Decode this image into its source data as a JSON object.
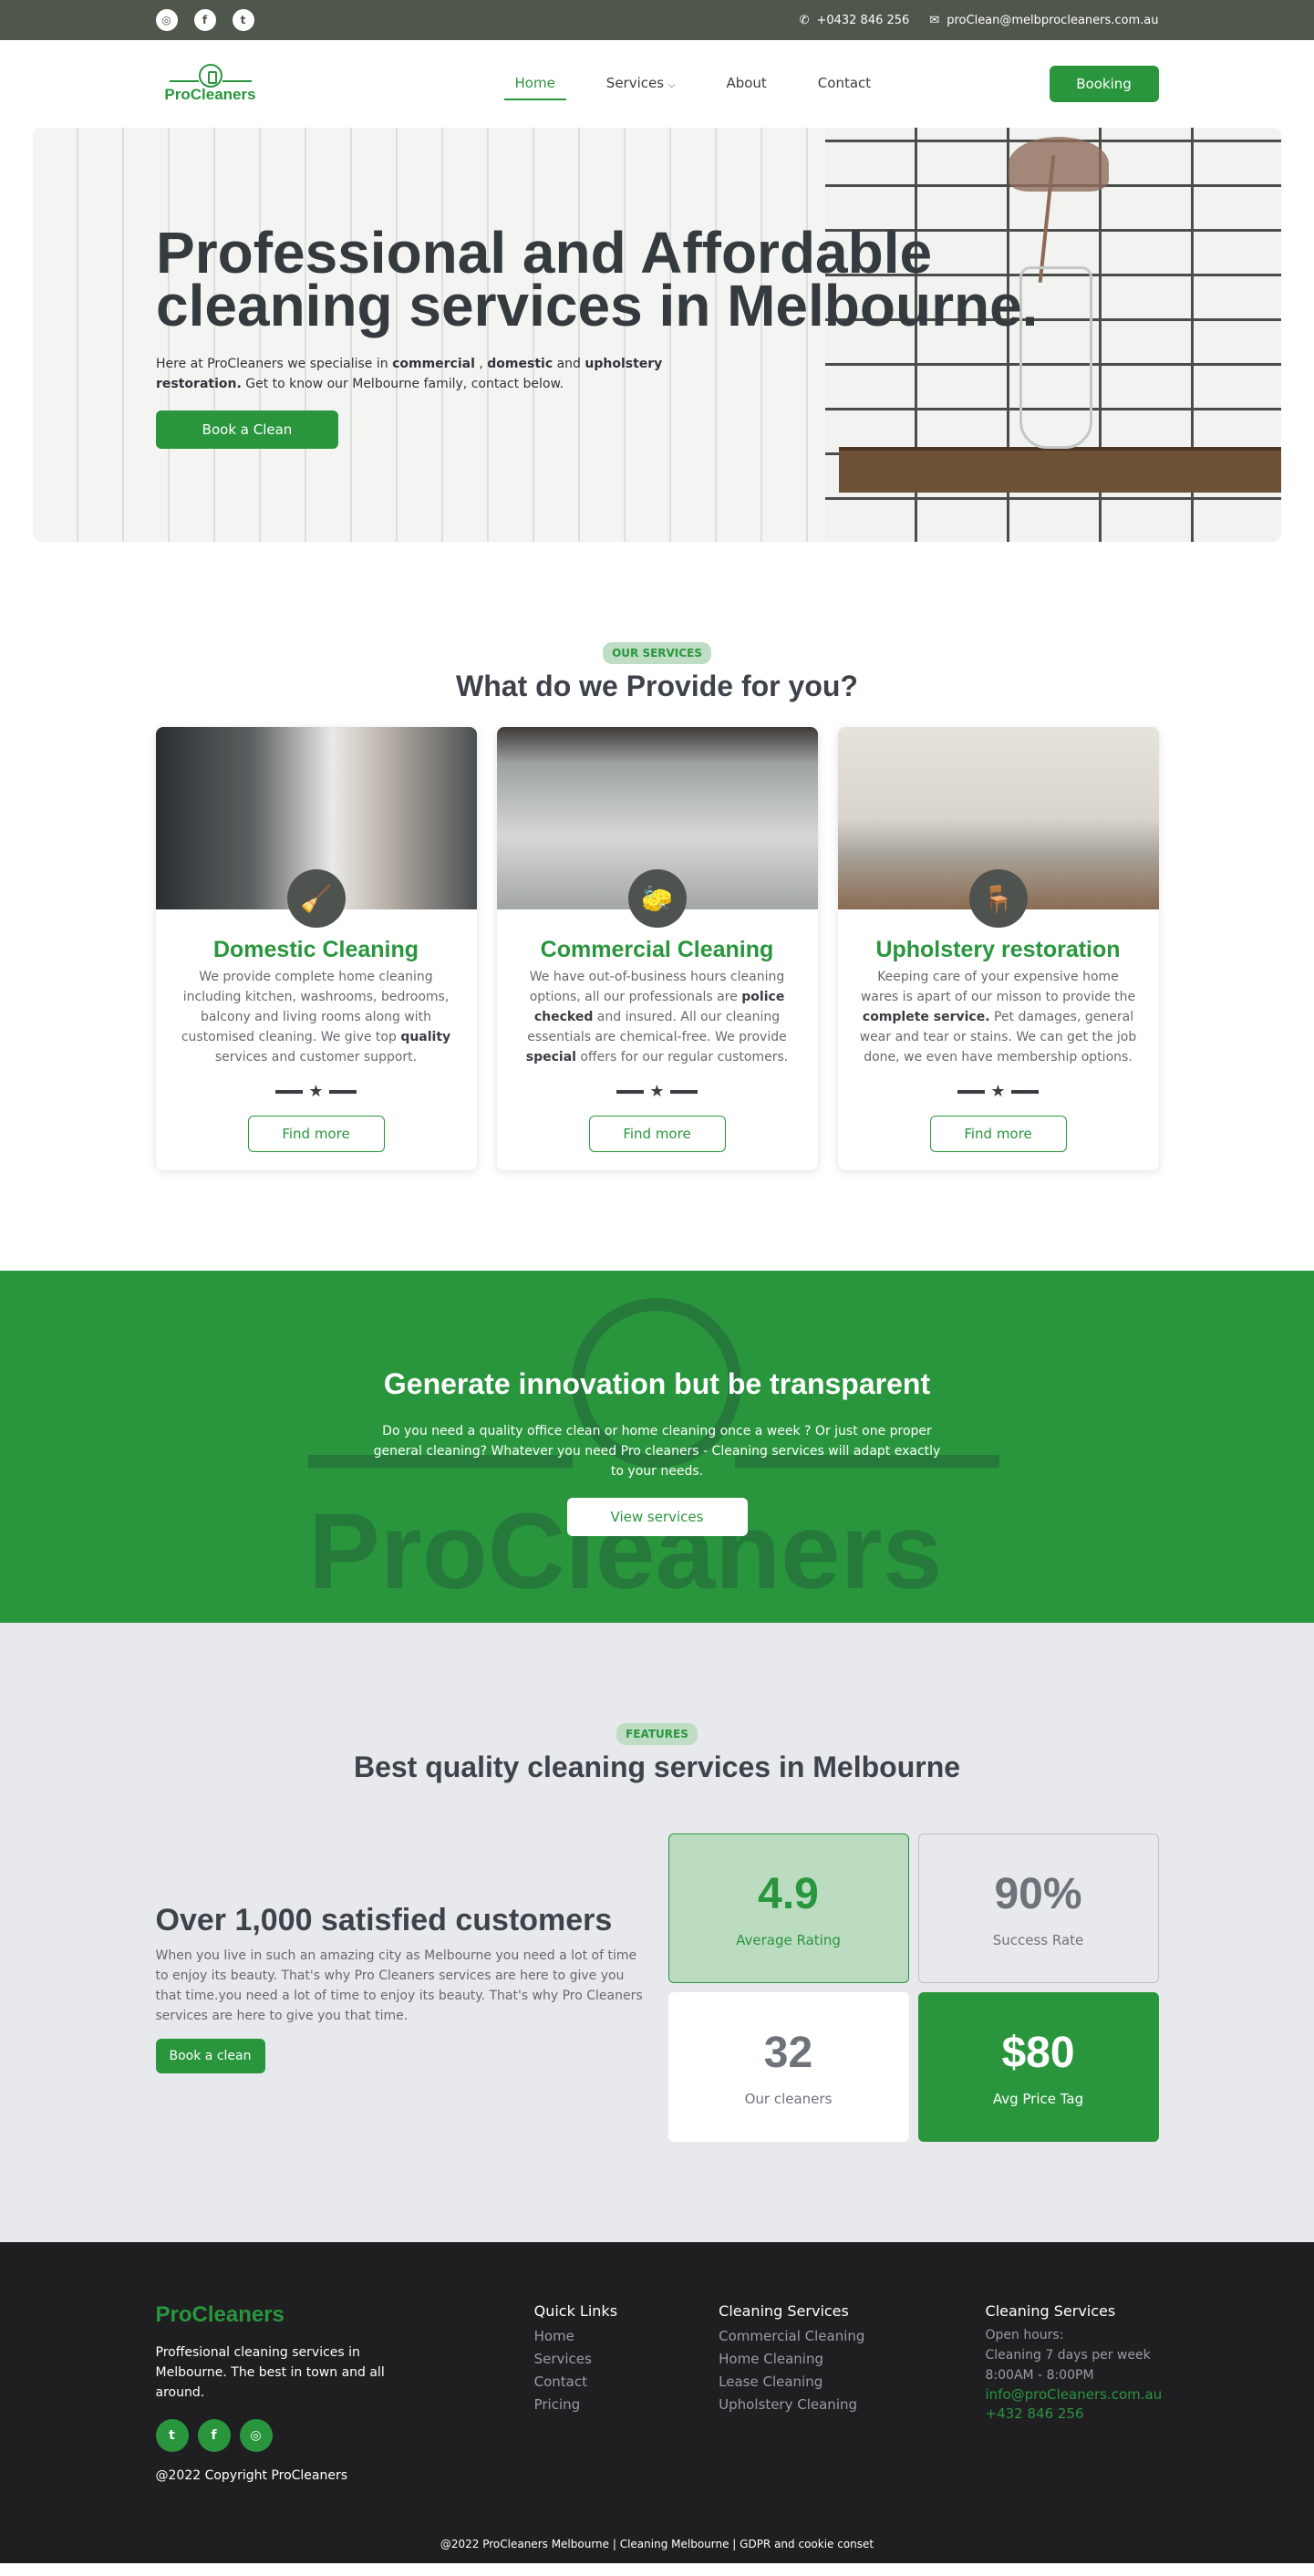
{
  "topbar": {
    "phone": "+0432 846 256",
    "email": "proClean@melbprocleaners.com.au"
  },
  "nav": {
    "brand": "ProCleaners",
    "items": [
      "Home",
      "Services",
      "About",
      "Contact"
    ],
    "booking": "Booking"
  },
  "hero": {
    "title_line1": "Professional and Affordable",
    "title_line2": "cleaning services in Melbourne.",
    "text_a": "Here at ProCleaners we specialise in ",
    "text_b": "commercial",
    "text_c": " , ",
    "text_d": "domestic",
    "text_e": " and ",
    "text_f": "upholstery restoration.",
    "text_g": " Get to know our Melbourne family, contact below.",
    "cta": "Book a Clean"
  },
  "services": {
    "chip": "Our Services",
    "heading": "What do we Provide for you?",
    "cards": [
      {
        "title": "Domestic Cleaning",
        "p1": "We provide complete home cleaning including kitchen, washrooms, bedrooms, balcony and living rooms along with customised cleaning. We give top ",
        "b1": "quality",
        "p2": " services and customer support.",
        "button": "Find more"
      },
      {
        "title": "Commercial Cleaning",
        "p1": "We have out-of-business hours cleaning options, all our professionals are ",
        "b1": "police checked",
        "p2": " and insured. All our cleaning essentials are chemical-free. We provide ",
        "b2": "special",
        "p3": " offers for our regular customers.",
        "button": "Find more"
      },
      {
        "title": "Upholstery restoration",
        "p1": "Keeping care of your expensive home wares is apart of our misson to provide the ",
        "b1": "complete service.",
        "p2": " Pet damages, general wear and tear or stains. We can get the job done, we even have membership options.",
        "button": "Find more"
      }
    ]
  },
  "banner": {
    "heading": "Generate innovation but be transparent",
    "text": "Do you need a quality office clean or home cleaning once a week ? Or just one proper general cleaning? Whatever you need Pro cleaners - Cleaning services will adapt exactly to your needs.",
    "button": "View services",
    "watermark": "ProCleaners"
  },
  "features": {
    "chip": "Features",
    "heading": "Best quality cleaning services in Melbourne",
    "title": "Over 1,000 satisfied customers",
    "text": "When you live in such an amazing city as Melbourne you need a lot of time to enjoy its beauty. That's why Pro Cleaners services are here to give you that time.you need a lot of time to enjoy its beauty. That's why Pro Cleaners services are here to give you that time.",
    "button": "Book a clean",
    "stats": [
      {
        "num": "4.9",
        "label": "Average Rating"
      },
      {
        "num": "90%",
        "label": "Success Rate"
      },
      {
        "num": "32",
        "label": "Our cleaners"
      },
      {
        "num": "$80",
        "label": "Avg Price Tag"
      }
    ]
  },
  "footer": {
    "brand": "ProCleaners",
    "about": "Proffesional cleaning services in Melbourne. The best in town and all around.",
    "copyright": "@2022 Copyright ProCleaners",
    "quick_title": "Quick Links",
    "quick": [
      "Home",
      "Services",
      "Contact",
      "Pricing"
    ],
    "services_title": "Cleaning Services",
    "services": [
      "Commercial Cleaning",
      "Home Cleaning",
      "Lease Cleaning",
      "Upholstery Cleaning"
    ],
    "hours_title": "Cleaning Services",
    "hours": [
      "Open hours:",
      "Cleaning 7 days per week",
      "8:00AM - 8:00PM"
    ],
    "contact_email": "info@proCleaners.com.au",
    "contact_phone": "+432 846 256",
    "bottom": "@2022 ProCleaners Melbourne | Cleaning Melbourne | GDPR and cookie conset"
  }
}
